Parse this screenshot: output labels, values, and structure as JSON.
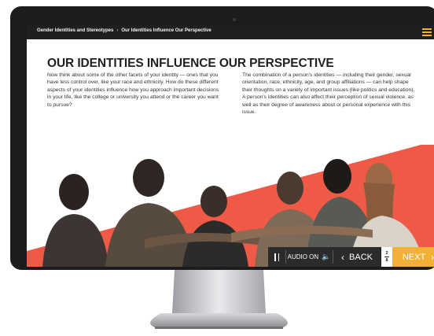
{
  "header": {
    "breadcrumb_parent": "Gender Identities and Stereotypes",
    "breadcrumb_separator": "›",
    "breadcrumb_current": "Our Identities Influence Our Perspective",
    "menu_icon": "hamburger-menu-icon"
  },
  "content": {
    "title": "OUR IDENTITIES INFLUENCE OUR PERSPECTIVE",
    "left_paragraph": "Now think about some of the other facets of your identity — ones that you have less control over, like your race and ethnicity. How do these different aspects of your identities influence how you approach important decisions in your life, like the college or university you attend or the career you want to pursue?",
    "right_paragraph": "The combination of a person's identities — including their gender, sexual orientation, race, ethnicity, age, and group affiliations — can help shape their thoughts on a variety of important issues (like politics and education). A person's identities can also affect their perception of sexual violence, as well as their degree of awareness about or personal experience with this issue."
  },
  "nav": {
    "audio_label": "AUDIO ON",
    "back_label": "BACK",
    "next_label": "NEXT",
    "page_current": "2",
    "page_total": "8"
  },
  "colors": {
    "accent": "#f2b134",
    "coral": "#ef5a47",
    "dark": "#1f1f1f"
  }
}
